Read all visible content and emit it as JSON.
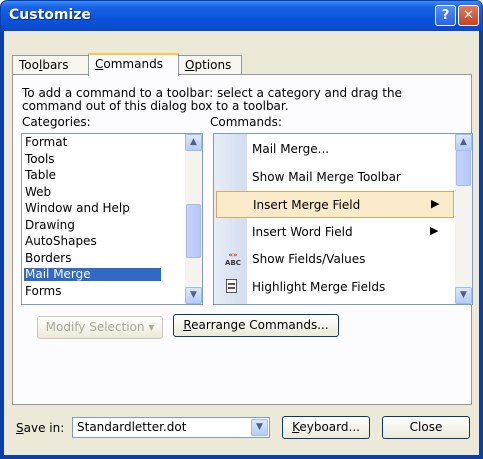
{
  "window": {
    "title": "Customize",
    "help_glyph": "?",
    "close_glyph": "✕"
  },
  "tabs": [
    {
      "label": "Toolbars",
      "hotkey_index": 3
    },
    {
      "label": "Commands",
      "hotkey_index": 0
    },
    {
      "label": "Options",
      "hotkey_index": 0
    }
  ],
  "instructions": {
    "line1": "To add a command to a toolbar: select a category and drag the",
    "line2": "command out of this dialog box to a toolbar."
  },
  "categories": {
    "label": "Categories:",
    "items": [
      "Format",
      "Tools",
      "Table",
      "Web",
      "Window and Help",
      "Drawing",
      "AutoShapes",
      "Borders",
      "Mail Merge",
      "Forms"
    ],
    "selected": "Mail Merge"
  },
  "commands": {
    "label": "Commands:",
    "items": [
      {
        "label": "Mail Merge...",
        "icon": "none",
        "submenu": false
      },
      {
        "label": "Show Mail Merge Toolbar",
        "icon": "none",
        "submenu": false
      },
      {
        "label": "Insert Merge Field",
        "icon": "none",
        "submenu": true
      },
      {
        "label": "Insert Word Field",
        "icon": "none",
        "submenu": true
      },
      {
        "label": "Show Fields/Values",
        "icon": "field-codes-icon",
        "icon_text": "«»ABC",
        "submenu": false
      },
      {
        "label": "Highlight Merge Fields",
        "icon": "highlight-fields-icon",
        "submenu": false
      }
    ],
    "selected": "Insert Merge Field"
  },
  "buttons": {
    "modify_selection": "Modify Selection ▾",
    "rearrange": "Rearrange Commands...",
    "keyboard": "Keyboard...",
    "close": "Close"
  },
  "save_in": {
    "label": "Save in:",
    "value": "Standardletter.dot"
  },
  "colors": {
    "titlebar": "#0c55de",
    "selection": "#316ac5",
    "hover": "#faeac9",
    "face": "#ece9d8"
  }
}
